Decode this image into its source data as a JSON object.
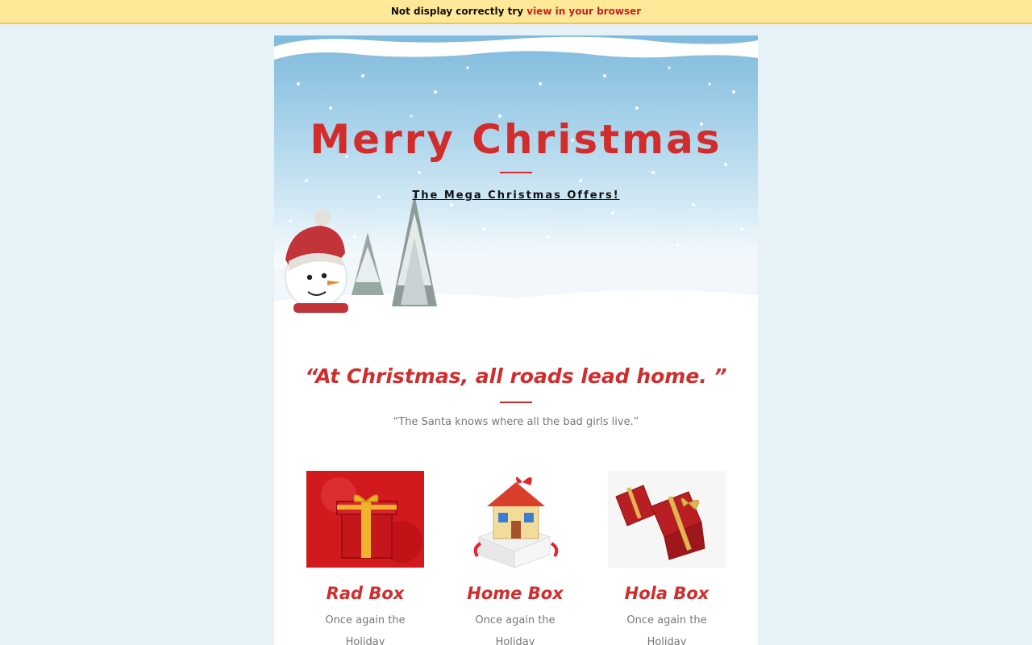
{
  "topbar": {
    "text": "Not display correctly try",
    "link": "view in your browser"
  },
  "hero": {
    "title": "Merry Christmas",
    "subtitle": "The Mega Christmas Offers!"
  },
  "quote": {
    "text": "“At Christmas, all roads lead home. ”",
    "sub": "“The Santa knows where all the bad girls live.”"
  },
  "products": [
    {
      "name": "Rad Box",
      "desc": "Once again the Holiday",
      "icon": "red-gift-box-image"
    },
    {
      "name": "Home Box",
      "desc": "Once again the Holiday",
      "icon": "house-gift-box-image"
    },
    {
      "name": "Hola Box",
      "desc": "Once again the Holiday",
      "icon": "open-gift-box-image"
    }
  ],
  "colors": {
    "accent": "#d22c2c",
    "topbar_bg": "#ffe898",
    "page_bg": "#e6f1f8"
  }
}
